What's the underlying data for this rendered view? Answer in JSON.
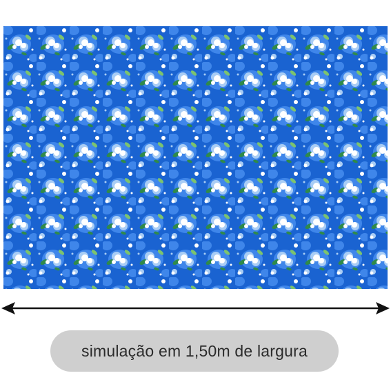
{
  "product": {
    "pattern_name": "blue-floral-repeat",
    "colors": {
      "background": "#1a63d1",
      "mid_blue": "#3f86ea",
      "light_blue": "#a9cdf5",
      "white": "#ffffff",
      "leaf_green": "#2f8a4a",
      "light_green": "#7cc36e"
    }
  },
  "measurement": {
    "arrow_icon": "double-headed-arrow-icon",
    "caption": "simulação em 1,50m de largura"
  }
}
